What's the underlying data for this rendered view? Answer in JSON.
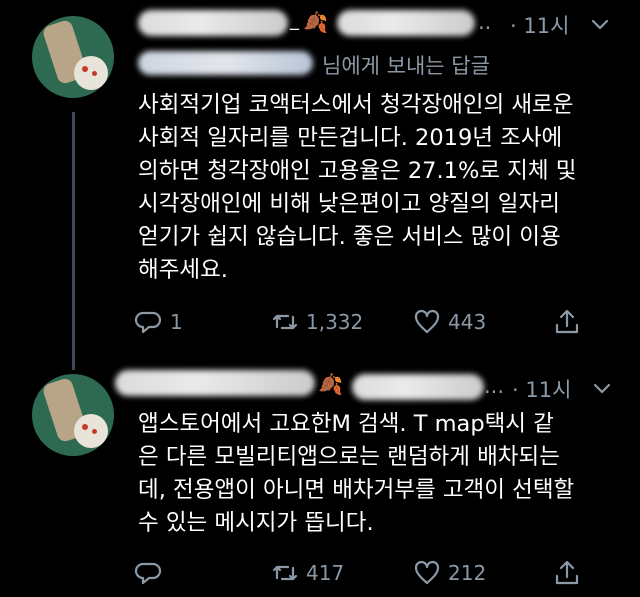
{
  "tweets": [
    {
      "time": "· 11시",
      "reply_to_suffix": "님에게 보내는 답글",
      "text": "사회적기업 코액터스에서 청각장애인의 새로운\n사회적 일자리를 만든겁니다. 2019년 조사에\n의하면 청각장애인 고용율은 27.1%로 지체 및\n시각장애인에 비해 낮은편이고 양질의 일자리\n얻기가 쉽지 않습니다. 좋은 서비스 많이 이용\n해주세요.",
      "handle_tail": "_",
      "ellipsis": "..",
      "replies": "1",
      "retweets": "1,332",
      "likes": "443"
    },
    {
      "time": "· 11시",
      "text": "앱스토어에서 고요한M 검색. T map택시 같\n은 다른 모빌리티앱으로는 랜덤하게 배차되는\n데, 전용앱이 아니면 배차거부를 고객이 선택할\n수 있는 메시지가 뜹니다.",
      "ellipsis": "...",
      "replies": "",
      "retweets": "417",
      "likes": "212"
    }
  ],
  "icons": {
    "reply": "reply-icon",
    "retweet": "retweet-icon",
    "like": "heart-icon",
    "share": "share-icon",
    "more": "chevron-down-icon",
    "decor": "autumn-leaf-icon"
  },
  "colors": {
    "background": "#000000",
    "text": "#ffffff",
    "muted": "#8b98a5",
    "thread_line": "#3d4a55"
  }
}
